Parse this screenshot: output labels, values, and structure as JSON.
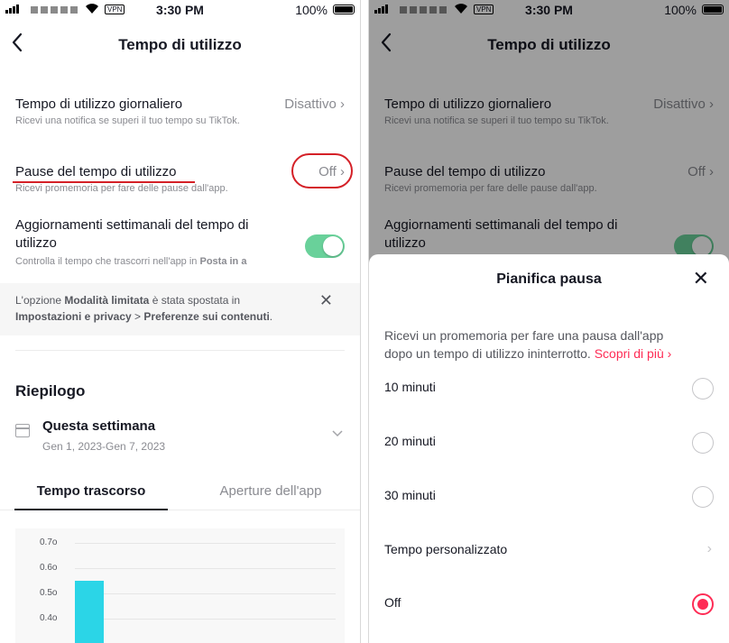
{
  "status": {
    "time": "3:30 PM",
    "battery": "100%",
    "vpn": "VPN",
    "wifi_icon": "wifi-icon"
  },
  "screen": {
    "title": "Tempo di utilizzo",
    "back_icon": "back-chevron-icon",
    "daily": {
      "title": "Tempo di utilizzo giornaliero",
      "value": "Disattivo",
      "sub": "Ricevi una notifica se superi il tuo tempo su TikTok."
    },
    "pause": {
      "title": "Pause del tempo di utilizzo",
      "value": "Off",
      "sub": "Ricevi promemoria per fare delle pause dall'app."
    },
    "weekly": {
      "title_line1": "Aggiornamenti settimanali del tempo di",
      "title_line2": "utilizzo",
      "sub_prefix": "Controlla il tempo che trascorri nell'app in ",
      "sub_bold": "Posta in a"
    },
    "notice": {
      "t1": "L'opzione ",
      "b1": "Modalità limitata",
      "t2": " è stata spostata in",
      "b2": "Impostazioni e privacy",
      "t3": " > ",
      "b3": "Preferenze sui contenuti",
      "t4": "."
    },
    "summary_title": "Riepilogo",
    "week_title": "Questa settimana",
    "week_range": "Gen 1, 2023-Gen 7, 2023",
    "tabs": [
      "Tempo trascorso",
      "Aperture dell'app"
    ]
  },
  "chart_data": {
    "type": "bar",
    "y_ticks": [
      "0.7o",
      "0.6o",
      "0.5o",
      "0.4o"
    ],
    "ylim": [
      0.35,
      0.75
    ],
    "values": [
      0.55
    ]
  },
  "sheet": {
    "title": "Pianifica pausa",
    "desc_line1": "Ricevi un promemoria per fare una pausa dall'app",
    "desc_line2": "dopo un tempo di utilizzo ininterrotto. ",
    "link": "Scopri di più",
    "options": [
      {
        "label": "10 minuti",
        "selected": false
      },
      {
        "label": "20 minuti",
        "selected": false
      },
      {
        "label": "30 minuti",
        "selected": false
      },
      {
        "label": "Tempo personalizzato",
        "chevron": true
      },
      {
        "label": "Off",
        "selected": true
      }
    ]
  },
  "colors": {
    "accent": "#fe2c55",
    "toggle_on": "#69d19a",
    "bar": "#2bd5e7",
    "annotation": "#d42027"
  }
}
